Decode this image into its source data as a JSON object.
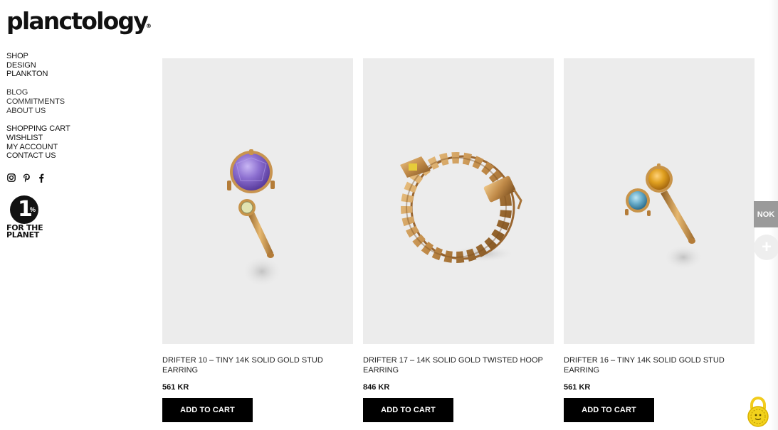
{
  "brand": {
    "logo": "planctology",
    "logo_mark": "®"
  },
  "nav": {
    "primary": [
      "SHOP",
      "DESIGN",
      "PLANKTON"
    ],
    "secondary": [
      "BLOG",
      "COMMITMENTS",
      "ABOUT US"
    ],
    "account": [
      "SHOPPING CART",
      "WISHLIST",
      "MY ACCOUNT",
      "CONTACT US"
    ]
  },
  "social": [
    "instagram-icon",
    "pinterest-icon",
    "facebook-icon"
  ],
  "badge": {
    "number": "1",
    "percent": "%",
    "line1": "FOR THE",
    "line2": "PLANET"
  },
  "products": [
    {
      "title": "DRIFTER 10 – TINY 14K SOLID GOLD STUD EARRING",
      "price": "561 KR",
      "button": "ADD TO CART"
    },
    {
      "title": "DRIFTER 17 – 14K SOLID GOLD TWISTED HOOP EARRING",
      "price": "846 KR",
      "button": "ADD TO CART"
    },
    {
      "title": "DRIFTER 16 – TINY 14K SOLID GOLD STUD EARRING",
      "price": "561 KR",
      "button": "ADD TO CART"
    }
  ],
  "currency": "NOK",
  "plus_label": "+",
  "colors": {
    "product_bg": "#ececec",
    "button_bg": "#000000",
    "gold": "#c8944a",
    "amethyst": "#8c6fd0",
    "citrine": "#e0a020",
    "topaz": "#6aaecb"
  }
}
